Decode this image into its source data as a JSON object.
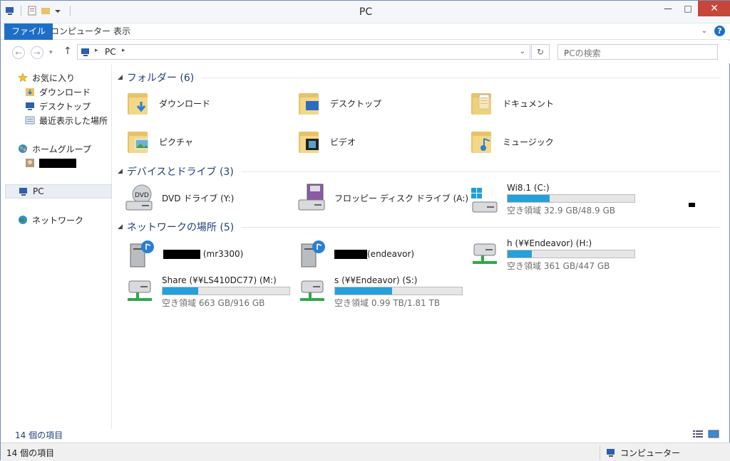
{
  "window": {
    "title": "PC"
  },
  "ribbon": {
    "tabs": [
      "ファイル",
      "コンピューター",
      "表示"
    ]
  },
  "address": {
    "path": "PC",
    "search_placeholder": "PCの検索"
  },
  "nav": {
    "favorites": "お気に入り",
    "fav_items": [
      "ダウンロード",
      "デスクトップ",
      "最近表示した場所"
    ],
    "homegroup": "ホームグループ",
    "pc": "PC",
    "network": "ネットワーク"
  },
  "groups": {
    "folders": "フォルダー (6)",
    "devices": "デバイスとドライブ (3)",
    "network": "ネットワークの場所 (5)"
  },
  "folders": [
    "ダウンロード",
    "デスクトップ",
    "ドキュメント",
    "ピクチャ",
    "ビデオ",
    "ミュージック"
  ],
  "devices": [
    {
      "label": "DVD ドライブ (Y:)"
    },
    {
      "label": "フロッピー ディスク ドライブ (A:)"
    },
    {
      "label": "Wi8.1 (C:)",
      "free": "空き領域 32.9 GB/48.9 GB",
      "used_fraction": 0.33
    }
  ],
  "network_items": [
    {
      "suffix": "(mr3300)"
    },
    {
      "suffix": "(endeavor)"
    },
    {
      "label": "h (¥¥Endeavor) (H:)",
      "free": "空き領域 361 GB/447 GB",
      "used_fraction": 0.19
    },
    {
      "label": "Share (¥¥LS410DC77) (M:)",
      "free": "空き領域 663 GB/916 GB",
      "used_fraction": 0.28
    },
    {
      "label": "s (¥¥Endeavor) (S:)",
      "free": "空き領域 0.99 TB/1.81 TB",
      "used_fraction": 0.45
    }
  ],
  "status": {
    "items_inner": "14 個の項目",
    "items": "14 個の項目",
    "computer": "コンピューター"
  },
  "colors": {
    "accent": "#1e6ec8",
    "bar": "#26a0da",
    "group_header": "#1e3f7a"
  }
}
